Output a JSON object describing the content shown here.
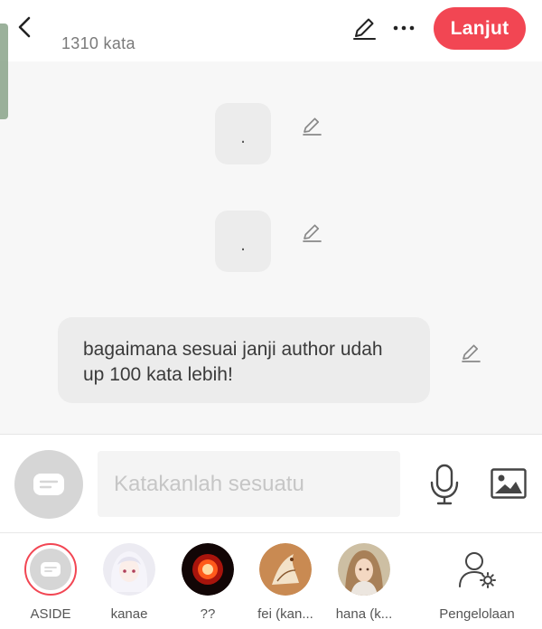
{
  "header": {
    "word_count": "1310 kata",
    "next_label": "Lanjut"
  },
  "chat": {
    "messages": [
      {
        "text": "."
      },
      {
        "text": "."
      },
      {
        "text": "bagaimana sesuai janji author udah up 100 kata lebih!"
      }
    ]
  },
  "composer": {
    "placeholder": "Katakanlah sesuatu"
  },
  "characters": [
    {
      "name": "ASIDE"
    },
    {
      "name": "kanae"
    },
    {
      "name": "??"
    },
    {
      "name": "fei (kan..."
    },
    {
      "name": "hana (k..."
    },
    {
      "name": "Pengelolaan"
    }
  ],
  "colors": {
    "accent": "#f24653",
    "chat_background": "#f7f7f7",
    "bubble": "#ececec"
  }
}
